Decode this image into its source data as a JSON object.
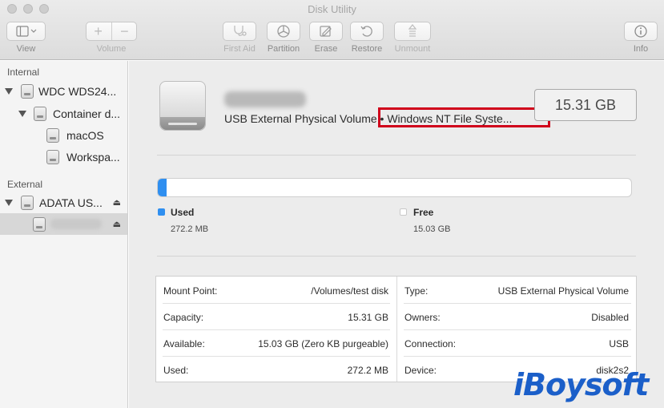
{
  "window": {
    "title": "Disk Utility"
  },
  "toolbar": {
    "view_label": "View",
    "volume_label": "Volume",
    "first_aid_label": "First Aid",
    "partition_label": "Partition",
    "erase_label": "Erase",
    "restore_label": "Restore",
    "unmount_label": "Unmount",
    "info_label": "Info",
    "add_glyph": "+",
    "remove_glyph": "−"
  },
  "sidebar": {
    "internal_header": "Internal",
    "external_header": "External",
    "items": [
      {
        "label": "WDC WDS24..."
      },
      {
        "label": "Container d..."
      },
      {
        "label": "macOS"
      },
      {
        "label": "Workspa..."
      },
      {
        "label": "ADATA US..."
      }
    ]
  },
  "volume": {
    "description": "USB External Physical Volume",
    "filesystem": "• Windows NT File Syste...",
    "size": "15.31 GB"
  },
  "usage": {
    "used_fraction": 0.0178,
    "used_label": "Used",
    "used_value": "272.2 MB",
    "free_label": "Free",
    "free_value": "15.03 GB",
    "used_color": "#2f8ff0"
  },
  "info": {
    "left": [
      {
        "key": "Mount Point:",
        "value": "/Volumes/test disk"
      },
      {
        "key": "Capacity:",
        "value": "15.31 GB"
      },
      {
        "key": "Available:",
        "value": "15.03 GB (Zero KB purgeable)"
      },
      {
        "key": "Used:",
        "value": "272.2 MB"
      }
    ],
    "right": [
      {
        "key": "Type:",
        "value": "USB External Physical Volume"
      },
      {
        "key": "Owners:",
        "value": "Disabled"
      },
      {
        "key": "Connection:",
        "value": "USB"
      },
      {
        "key": "Device:",
        "value": "disk2s2"
      }
    ]
  },
  "watermark": {
    "text": "iBoysoft"
  }
}
